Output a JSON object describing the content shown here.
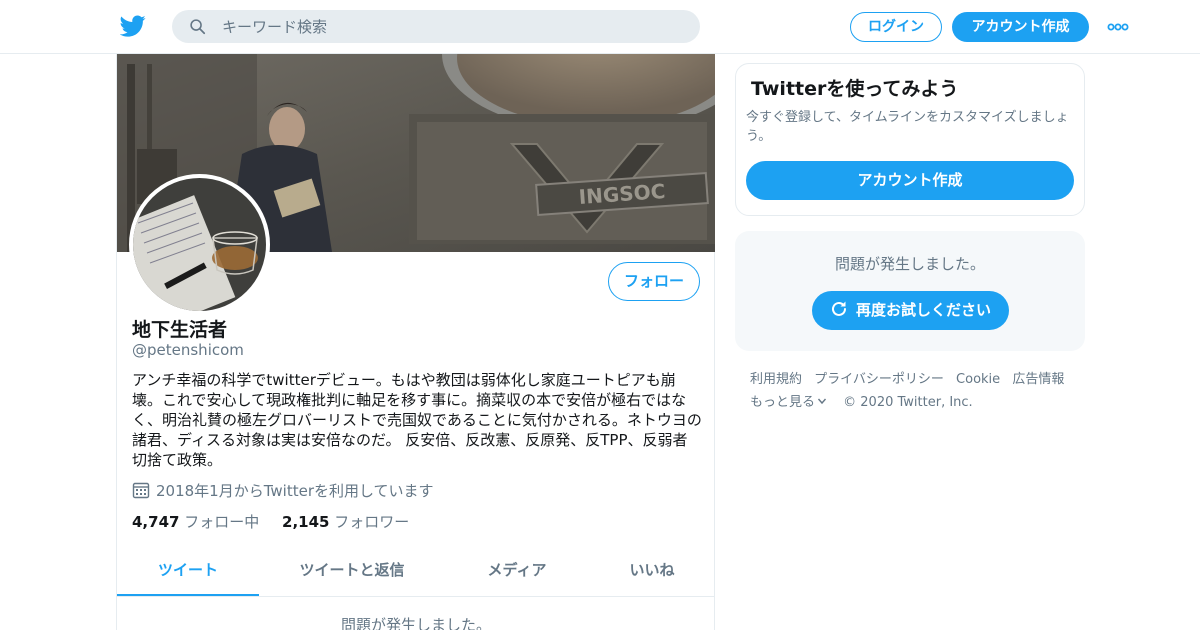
{
  "colors": {
    "accent": "#1da1f2",
    "text": "#14171a",
    "muted": "#657786",
    "border": "#e6ecf0",
    "panel": "#f5f8fa"
  },
  "topbar": {
    "logo_icon": "twitter-bird-icon",
    "search_placeholder": "キーワード検索",
    "login_label": "ログイン",
    "signup_label": "アカウント作成",
    "more_icon": "more-dots-icon"
  },
  "profile": {
    "banner_image": "banner-photo",
    "avatar_image": "avatar-photo",
    "banner_sign_text": "INGSOC",
    "follow_label": "フォロー",
    "name": "地下生活者",
    "handle": "@petenshicom",
    "bio": "アンチ幸福の科学でtwitterデビュー。もはや教団は弱体化し家庭ユートピアも崩壊。これで安心して現政権批判に軸足を移す事に。摘菜収の本で安倍が極右ではなく、明治礼賛の極左グロバーリストで売国奴であることに気付かされる。ネトウヨの諸君、ディスる対象は実は安倍なのだ。 反安倍、反改憲、反原発、反TPP、反弱者切捨て政策。",
    "joined": "2018年1月からTwitterを利用しています",
    "following_count": "4,747",
    "following_label": "フォロー中",
    "followers_count": "2,145",
    "followers_label": "フォロワー",
    "tabs": [
      {
        "label": "ツイート",
        "active": true
      },
      {
        "label": "ツイートと返信",
        "active": false
      },
      {
        "label": "メディア",
        "active": false
      },
      {
        "label": "いいね",
        "active": false
      }
    ],
    "tweets_error": "問題が発生しました。"
  },
  "sidebar": {
    "signup_title": "Twitterを使ってみよう",
    "signup_desc": "今すぐ登録して、タイムラインをカスタマイズしましょう。",
    "signup_cta": "アカウント作成",
    "error_msg": "問題が発生しました。",
    "retry_label": "再度お試しください",
    "footer": {
      "terms": "利用規約",
      "privacy": "プライバシーポリシー",
      "cookie": "Cookie",
      "ads": "広告情報",
      "more": "もっと見る",
      "copyright": "© 2020 Twitter, Inc."
    }
  }
}
